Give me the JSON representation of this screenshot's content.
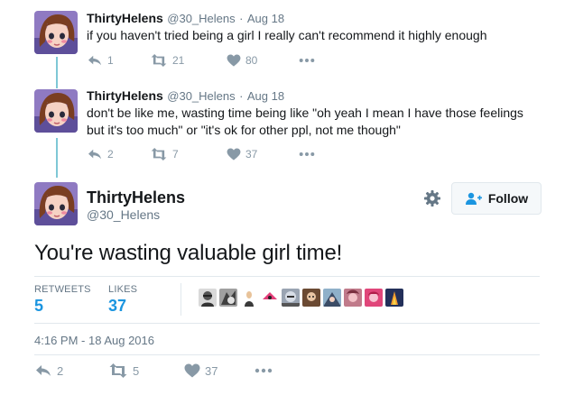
{
  "tweets": [
    {
      "name": "ThirtyHelens",
      "handle": "@30_Helens",
      "sep": "·",
      "date": "Aug 18",
      "text": "if you haven't tried being a girl I really can't recommend it highly enough",
      "replies": "1",
      "retweets": "21",
      "likes": "80"
    },
    {
      "name": "ThirtyHelens",
      "handle": "@30_Helens",
      "sep": "·",
      "date": "Aug 18",
      "text_line1": "don't be like me, wasting time being like \"oh yeah I mean I have those feelings",
      "text_line2": "but it's too much\" or \"it's ok for other ppl, not me though\"",
      "replies": "2",
      "retweets": "7",
      "likes": "37"
    }
  ],
  "main": {
    "name": "ThirtyHelens",
    "handle": "@30_Helens",
    "follow_label": "Follow",
    "text": "You're wasting valuable girl time!",
    "retweets_label": "RETWEETS",
    "retweets": "5",
    "likes_label": "LIKES",
    "likes": "37",
    "timestamp": "4:16 PM - 18 Aug 2016",
    "replies": "2",
    "action_retweets": "5",
    "action_likes": "37"
  },
  "icons": {
    "reply": "reply-icon",
    "retweet": "retweet-icon",
    "like": "heart-icon",
    "more": "more-icon",
    "gear": "gear-icon",
    "follow": "follow-person-icon"
  },
  "colors": {
    "accent": "#1b95e0",
    "thread_line": "#7fc8d6",
    "action_gray": "#8899a6"
  },
  "likers_count_shown": 10
}
